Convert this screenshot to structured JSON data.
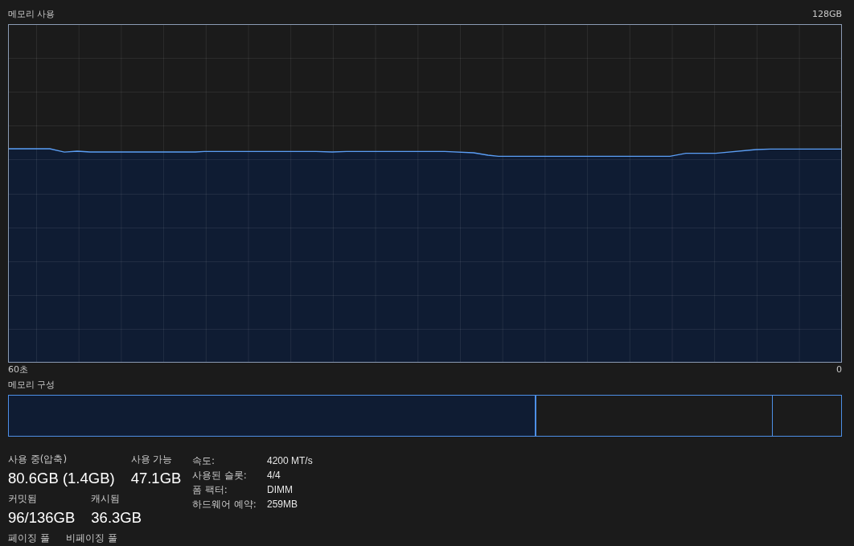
{
  "graph": {
    "title": "메모리 사용",
    "max_label": "128GB",
    "x_start_label": "60초",
    "x_end_label": "0"
  },
  "composition": {
    "title": "메모리 구성"
  },
  "stat_rows": [
    {
      "items": [
        {
          "label": "사용 중(압축)",
          "value": "80.6GB (1.4GB)"
        },
        {
          "label": "사용 가능",
          "value": "47.1GB"
        }
      ]
    },
    {
      "items": [
        {
          "label": "커밋됨",
          "value": "96/136GB"
        },
        {
          "label": "캐시됨",
          "value": "36.3GB"
        }
      ]
    },
    {
      "items": [
        {
          "label": "페이징 풀"
        },
        {
          "label": "비페이징 풀"
        }
      ]
    }
  ],
  "details": [
    {
      "label": "속도:",
      "value": "4200 MT/s"
    },
    {
      "label": "사용된 슬롯:",
      "value": "4/4"
    },
    {
      "label": "폼 팩터:",
      "value": "DIMM"
    },
    {
      "label": "하드웨어 예약:",
      "value": "259MB"
    }
  ]
}
